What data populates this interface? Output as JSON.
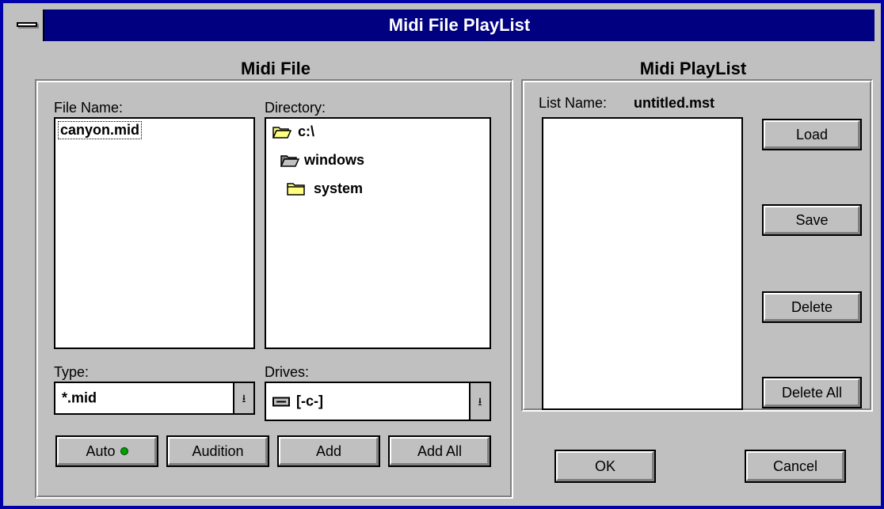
{
  "window": {
    "title": "Midi File PlayList"
  },
  "midi_file": {
    "section_title": "Midi File",
    "file_name_label": "File Name:",
    "files": [
      "canyon.mid"
    ],
    "directory_label": "Directory:",
    "directories": [
      "c:\\",
      "windows",
      "system"
    ],
    "type_label": "Type:",
    "type_value": "*.mid",
    "drives_label": "Drives:",
    "drives_value": "[-c-]",
    "buttons": {
      "auto": "Auto",
      "audition": "Audition",
      "add": "Add",
      "add_all": "Add All"
    }
  },
  "playlist": {
    "section_title": "Midi PlayList",
    "list_name_label": "List Name:",
    "list_name_value": "untitled.mst",
    "items": [],
    "buttons": {
      "load": "Load",
      "save": "Save",
      "delete": "Delete",
      "delete_all": "Delete All"
    }
  },
  "footer": {
    "ok": "OK",
    "cancel": "Cancel"
  },
  "icons": {
    "system_menu": "system-menu-icon",
    "folder_open": "folder-open-icon",
    "folder_closed": "folder-icon",
    "drive": "hard-drive-icon",
    "dropdown": "dropdown-arrow-icon",
    "led": "green-led-icon"
  },
  "colors": {
    "titlebar": "#000080",
    "face": "#c0c0c0",
    "led": "#00a000"
  }
}
